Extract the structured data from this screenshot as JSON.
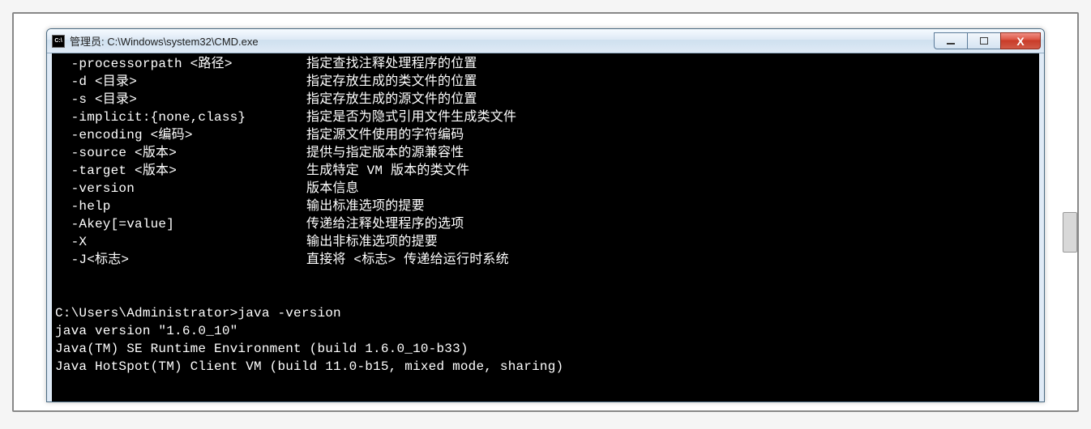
{
  "window": {
    "title": "管理员: C:\\Windows\\system32\\CMD.exe",
    "icon_label": "C:\\"
  },
  "options": [
    {
      "flag": "  -processorpath <路径>",
      "desc": "指定查找注释处理程序的位置"
    },
    {
      "flag": "  -d <目录>",
      "desc": "指定存放生成的类文件的位置"
    },
    {
      "flag": "  -s <目录>",
      "desc": "指定存放生成的源文件的位置"
    },
    {
      "flag": "  -implicit:{none,class}",
      "desc": "指定是否为隐式引用文件生成类文件"
    },
    {
      "flag": "  -encoding <编码>",
      "desc": "指定源文件使用的字符编码"
    },
    {
      "flag": "  -source <版本>",
      "desc": "提供与指定版本的源兼容性"
    },
    {
      "flag": "  -target <版本>",
      "desc": "生成特定 VM 版本的类文件"
    },
    {
      "flag": "  -version",
      "desc": "版本信息"
    },
    {
      "flag": "  -help",
      "desc": "输出标准选项的提要"
    },
    {
      "flag": "  -Akey[=value]",
      "desc": "传递给注释处理程序的选项"
    },
    {
      "flag": "  -X",
      "desc": "输出非标准选项的提要"
    },
    {
      "flag": "  -J<标志>",
      "desc": "直接将 <标志> 传递给运行时系统"
    }
  ],
  "session": {
    "prompt_line": "C:\\Users\\Administrator>java -version",
    "output": [
      "java version \"1.6.0_10\"",
      "Java(TM) SE Runtime Environment (build 1.6.0_10-b33)",
      "Java HotSpot(TM) Client VM (build 11.0-b15, mixed mode, sharing)"
    ]
  }
}
